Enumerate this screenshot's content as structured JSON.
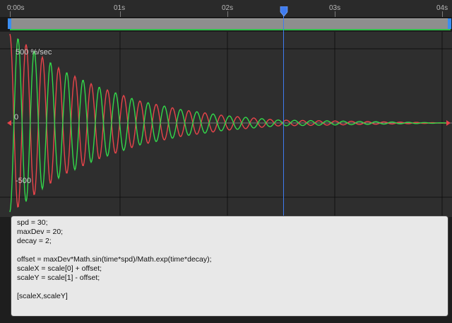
{
  "timeline": {
    "ruler_labels": [
      "0:00s",
      "01s",
      "02s",
      "03s",
      "04s"
    ],
    "current_time_seconds": 2.55,
    "work_area_color": "#2fc24b"
  },
  "graph": {
    "y_top_label": "500 %/sec",
    "y_zero_label": "0",
    "y_bottom_label": "-500"
  },
  "chart_data": {
    "type": "line",
    "xlabel": "",
    "ylabel": "",
    "xlim": [
      0,
      4.1
    ],
    "ylim": [
      -600,
      600
    ],
    "grid": true,
    "series": [
      {
        "color": "#e8444a",
        "t": [
          0,
          0.1,
          0.2,
          0.3,
          0.5,
          0.8,
          1.2,
          1.6,
          2.0,
          2.5,
          4.1
        ],
        "amplitude": [
          600,
          560,
          500,
          445,
          350,
          250,
          150,
          90,
          50,
          20,
          0
        ]
      },
      {
        "color": "#33d84a",
        "t": [
          0,
          0.1,
          0.2,
          0.3,
          0.5,
          0.8,
          1.2,
          1.6,
          2.0,
          2.5,
          4.1
        ],
        "amplitude": [
          600,
          560,
          500,
          445,
          350,
          250,
          150,
          90,
          50,
          20,
          0
        ]
      }
    ],
    "note_frequency_hz": 6.6
  },
  "editor": {
    "lines": [
      "spd = 30;",
      "maxDev = 20;",
      "decay = 2;",
      "",
      "offset = maxDev*Math.sin(time*spd)/Math.exp(time*decay);",
      "scaleX = scale[0] + offset;",
      "scaleY = scale[1] - offset;",
      "",
      "[scaleX,scaleY]"
    ]
  },
  "icons": {
    "playhead": "playhead-icon",
    "work_start": "work-area-start-handle",
    "work_end": "work-area-end-handle"
  },
  "colors": {
    "accent": "#3f7cf0",
    "red_curve": "#e8444a",
    "green_curve": "#33d84a",
    "grid_line": "#111111",
    "zero_line": "#777777"
  }
}
